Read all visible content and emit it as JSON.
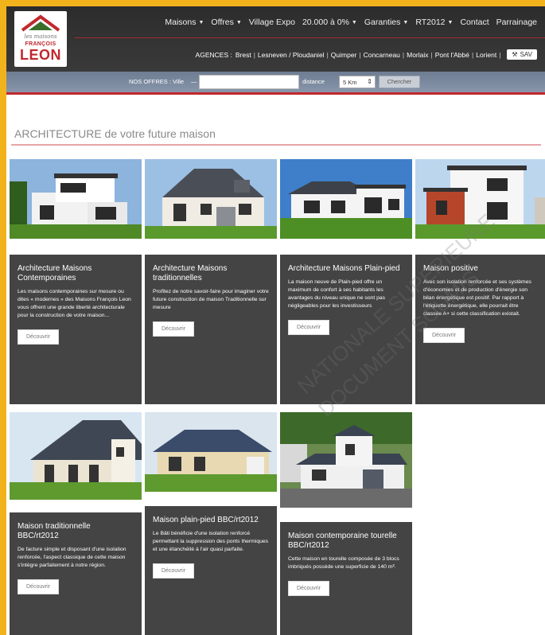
{
  "brand": {
    "logo_sub": "les maisons",
    "logo_top": "FRANÇOIS",
    "logo_name": "LEON"
  },
  "nav": {
    "items": [
      {
        "label": "Maisons",
        "caret": true
      },
      {
        "label": "Offres",
        "caret": true
      },
      {
        "label": "Village Expo",
        "caret": false
      },
      {
        "label": "20.000 à 0%",
        "caret": true
      },
      {
        "label": "Garanties",
        "caret": true
      },
      {
        "label": "RT2012",
        "caret": true
      },
      {
        "label": "Contact",
        "caret": false
      },
      {
        "label": "Parrainage",
        "caret": false
      }
    ],
    "agencies_label": "AGENCES :",
    "agencies": [
      "Brest",
      "Lesneven / Ploudaniel",
      "Quimper",
      "Concarneau",
      "Morlaix",
      "Pont l'Abbé",
      "Lorient"
    ],
    "sav_label": "SAV"
  },
  "search": {
    "offers_label": "NOS OFFRES : Ville",
    "city_placeholder": "",
    "distance_label": "distance",
    "distance_value": "5 Km",
    "button_label": "Chercher"
  },
  "section": {
    "title": "ARCHITECTURE de votre future maison"
  },
  "cards": [
    {
      "title": "Architecture Maisons Contemporaines",
      "text": "Les maisons contemporaines sur mesure ou dites « modernes » des Maisons François Leon vous offrent une grande liberté architecturale pour la construction de votre maison...",
      "button": "Découvrir"
    },
    {
      "title": "Architecture Maisons traditionnelles",
      "text": "Profitez de notre savoir-faire pour imaginer votre future construction de maison Traditionnelle sur mesure",
      "button": "Découvrir"
    },
    {
      "title": "Architecture Maisons Plain-pied",
      "text": "La maison neuve de Plain-pied offre un maximum de confort à ses habitants les avantages du niveau unique ne sont pas négligeables pour les investisseurs",
      "button": "Découvrir"
    },
    {
      "title": "Maison positive",
      "text": "Avec son isolation renforcée et ses systèmes d'économies et de production d'énergie son bilan énergétique est positif. Par rapport à l'étiquette énergétique, elle pourrait être classée A+ si cette classification existait.",
      "button": "Découvrir"
    },
    {
      "title": "Maison traditionnelle BBC/rt2012",
      "text": "De facture simple et disposant d'une isolation renforcée, l'aspect classique de cette maison s'intègre parfaitement à notre région.",
      "button": "Découvrir"
    },
    {
      "title": "Maison plain-pied BBC/rt2012",
      "text": "Le Bâti bénéficie d'une isolation renforcé permettant la suppression des ponts thermiques et une étanchéité à l'air quasi parfaite.",
      "button": "Découvrir"
    },
    {
      "title": "Maison contemporaine tourelle BBC/rt2012",
      "text": "Cette maison en tourelle composée de 3 blocs imbriqués possède une superficie de 140 m².",
      "button": "Découvrir"
    }
  ],
  "watermark": {
    "line1": "NATIONALE SUPERIEURE",
    "line2": "DOCUMENT SOUMIS"
  },
  "colors": {
    "accent_red": "#c0282d",
    "frame_yellow": "#f2b21c",
    "panel_grey": "#444444"
  }
}
